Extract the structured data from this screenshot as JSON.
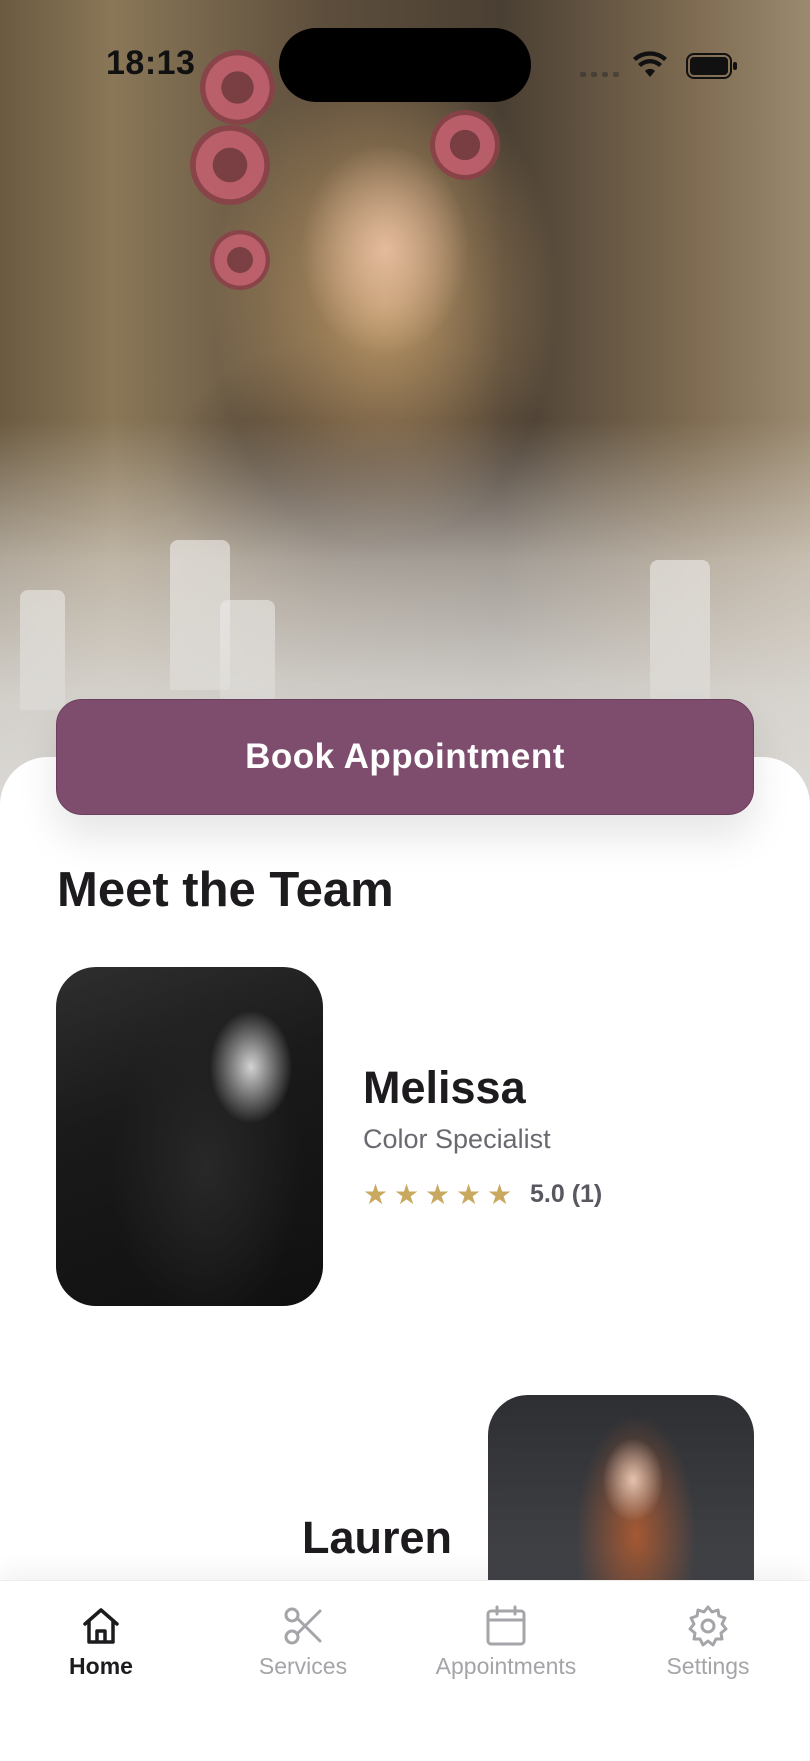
{
  "status_bar": {
    "time": "18:13"
  },
  "hero": {
    "book_button_label": "Book Appointment"
  },
  "team": {
    "title": "Meet the Team",
    "members": [
      {
        "name": "Melissa",
        "role": "Color Specialist",
        "rating_stars": 5,
        "rating_text": "5.0 (1)"
      },
      {
        "name": "Lauren"
      }
    ]
  },
  "colors": {
    "accent": "#7e4d6d",
    "star": "#c9a85f",
    "text_dark": "#1d1b1e",
    "text_muted": "#a6a4a8"
  },
  "tabbar": {
    "items": [
      {
        "label": "Home",
        "icon": "home-icon",
        "active": true
      },
      {
        "label": "Services",
        "icon": "scissors-icon",
        "active": false
      },
      {
        "label": "Appointments",
        "icon": "calendar-icon",
        "active": false
      },
      {
        "label": "Settings",
        "icon": "gear-icon",
        "active": false
      }
    ]
  }
}
